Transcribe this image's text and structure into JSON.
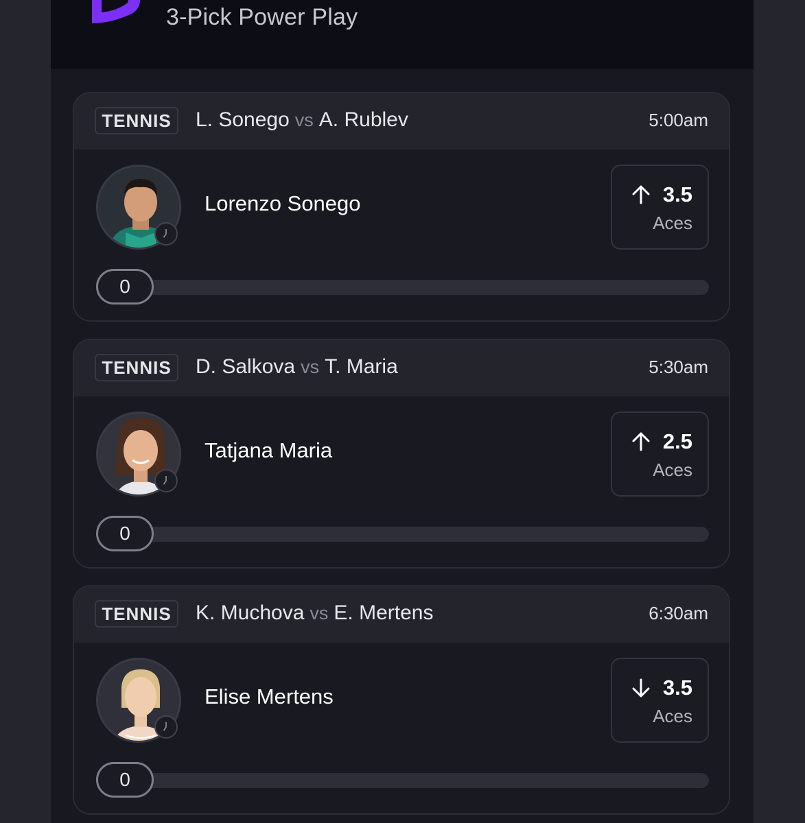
{
  "header": {
    "title": "3-Pick Power Play",
    "brand_color": "#7b2ff7"
  },
  "picks": [
    {
      "sport": "TENNIS",
      "home": "L. Sonego",
      "vs": "vs",
      "away": "A. Rublev",
      "time": "5:00am",
      "player": "Lorenzo Sonego",
      "direction": "up",
      "line": "3.5",
      "stat": "Aces",
      "progress": "0"
    },
    {
      "sport": "TENNIS",
      "home": "D. Salkova",
      "vs": "vs",
      "away": "T. Maria",
      "time": "5:30am",
      "player": "Tatjana Maria",
      "direction": "up",
      "line": "2.5",
      "stat": "Aces",
      "progress": "0"
    },
    {
      "sport": "TENNIS",
      "home": "K. Muchova",
      "vs": "vs",
      "away": "E. Mertens",
      "time": "6:30am",
      "player": "Elise Mertens",
      "direction": "down",
      "line": "3.5",
      "stat": "Aces",
      "progress": "0"
    }
  ]
}
